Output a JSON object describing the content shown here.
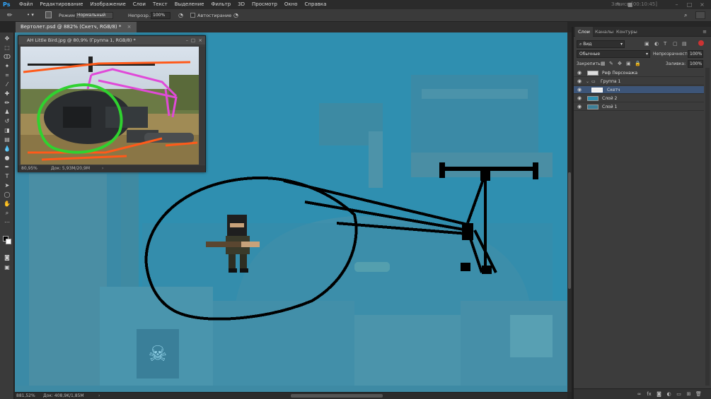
{
  "app": {
    "logo": "Ps",
    "window_title": "Запись [00:10:45]"
  },
  "menu": [
    "Файл",
    "Редактирование",
    "Изображение",
    "Слои",
    "Текст",
    "Выделение",
    "Фильтр",
    "3D",
    "Просмотр",
    "Окно",
    "Справка"
  ],
  "options": {
    "mode_label": "Режим:",
    "mode_value": "Нормальный",
    "opacity_label": "Непрозр.:",
    "opacity_value": "100%",
    "autoerase_label": "Автостирание"
  },
  "document": {
    "tab_label": "Вертолет.psd @ 882% (Скетч, RGB/8) *",
    "zoom": "881,52%",
    "doc_info": "Док: 408,9K/1,85M"
  },
  "reference_window": {
    "title": "AH Little Bird.jpg @ 80,9% (Группа 1, RGB/8) *",
    "zoom": "80,95%",
    "doc_info": "Док: 5,93M/20,9M"
  },
  "layers_panel": {
    "tabs": [
      "Слои",
      "Каналы",
      "Контуры"
    ],
    "kind_filter": "Вид",
    "blend_mode": "Обычные",
    "opacity_label": "Непрозрачность:",
    "opacity_value": "100%",
    "lock_label": "Закрепить:",
    "fill_label": "Заливка:",
    "fill_value": "100%",
    "layers": [
      {
        "name": "Реф Персонажа",
        "selected": false
      },
      {
        "name": "Группа 1",
        "selected": false
      },
      {
        "name": "Скетч",
        "selected": true
      },
      {
        "name": "Слой 2",
        "selected": false
      },
      {
        "name": "Слой 1",
        "selected": false
      }
    ]
  },
  "colors": {
    "canvas_bg": "#2f8fb0",
    "sketch_line": "#000000",
    "selected_layer": "#3d5578"
  }
}
